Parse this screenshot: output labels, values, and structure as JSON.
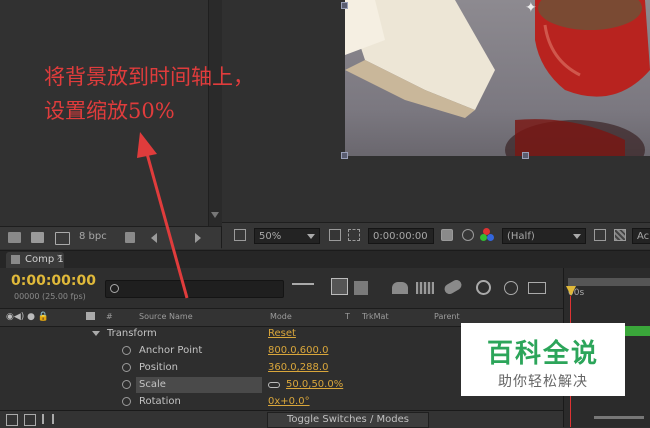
{
  "project_panel": {
    "bit_depth": "8 bpc"
  },
  "viewer": {
    "zoom": "50%",
    "timecode": "0:00:00:00",
    "resolution": "(Half)",
    "trailing_label": "Ac"
  },
  "timeline": {
    "tab_label": "Comp 1",
    "current_time": "0:00:00:00",
    "frame_info": "00000 (25.00 fps)",
    "search_placeholder": "",
    "columns": {
      "source_name": "Source Name",
      "mode": "Mode",
      "t": "T",
      "trkmat": "TrkMat",
      "parent": "Parent"
    },
    "ruler_label": "00s",
    "transform_label": "Transform",
    "reset_label": "Reset",
    "properties": [
      {
        "name": "Anchor Point",
        "value": "800.0,600.0"
      },
      {
        "name": "Position",
        "value": "360.0,288.0"
      },
      {
        "name": "Scale",
        "value": "50.0,50.0%"
      },
      {
        "name": "Rotation",
        "value": "0x+0.0°"
      }
    ],
    "toggle_label": "Toggle Switches / Modes"
  },
  "annotation": {
    "line1": "将背景放到时间轴上，",
    "line2": "设置缩放50%",
    "color": "#e03c3c"
  },
  "watermark": {
    "title": "百科全说",
    "subtitle": "助你轻松解决"
  },
  "colors": {
    "value_orange": "#d9a63b",
    "accent_green": "#2ca55a",
    "timecode_yellow": "#e0b93a"
  }
}
